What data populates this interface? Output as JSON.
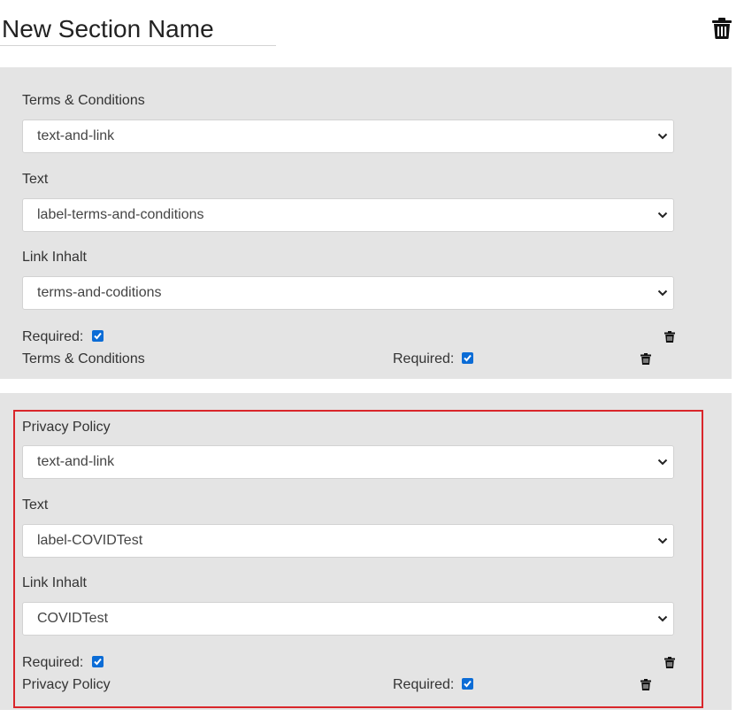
{
  "section": {
    "name": "New Section Name"
  },
  "blocks": [
    {
      "label": "Terms & Conditions",
      "type_value": "text-and-link",
      "text_label": "Text",
      "text_value": "label-terms-and-conditions",
      "link_label": "Link Inhalt",
      "link_value": "terms-and-coditions",
      "required_label": "Required:",
      "summary_title": "Terms & Conditions",
      "summary_required_label": "Required:"
    },
    {
      "label": "Privacy Policy",
      "type_value": "text-and-link",
      "text_label": "Text",
      "text_value": "label-COVIDTest",
      "link_label": "Link Inhalt",
      "link_value": "COVIDTest",
      "required_label": "Required:",
      "summary_title": "Privacy Policy",
      "summary_required_label": "Required:"
    }
  ],
  "colors": {
    "highlight": "#d9262b",
    "panel": "#e4e4e4",
    "checkbox": "#0b6cd6"
  },
  "icons": {
    "delete": "trash-icon",
    "dropdown": "chevron-down-icon",
    "check": "check-icon"
  }
}
